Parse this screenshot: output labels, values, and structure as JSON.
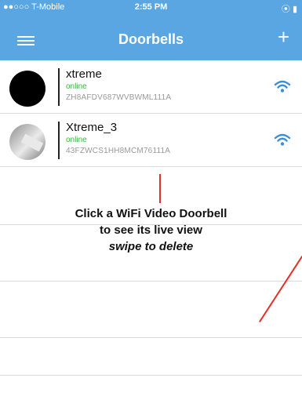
{
  "status_bar": {
    "carrier": "●●○○○ T-Mobile",
    "wifi_glyph": "≈",
    "time": "2:55 PM",
    "right": "⦿ ▮"
  },
  "nav": {
    "title": "Doorbells",
    "add_label": "+",
    "menu_icon": "hamburger-icon"
  },
  "doorbells": [
    {
      "name": "xtreme",
      "status": "online",
      "serial": "ZH8AFDV687WVBWML111A",
      "avatar": "black-circle"
    },
    {
      "name": "Xtreme_3",
      "status": "online",
      "serial": "43FZWCS1HH8MCM76111A",
      "avatar": "photo"
    }
  ],
  "instruction": {
    "line1": "Click a WiFi Video Doorbell",
    "line2": "to see its live view",
    "line3": "swipe to delete"
  },
  "colors": {
    "nav_bg": "#5aa6e3",
    "online": "#3fb13f",
    "annotation": "#e53025",
    "wifi": "#3a8fd8"
  }
}
